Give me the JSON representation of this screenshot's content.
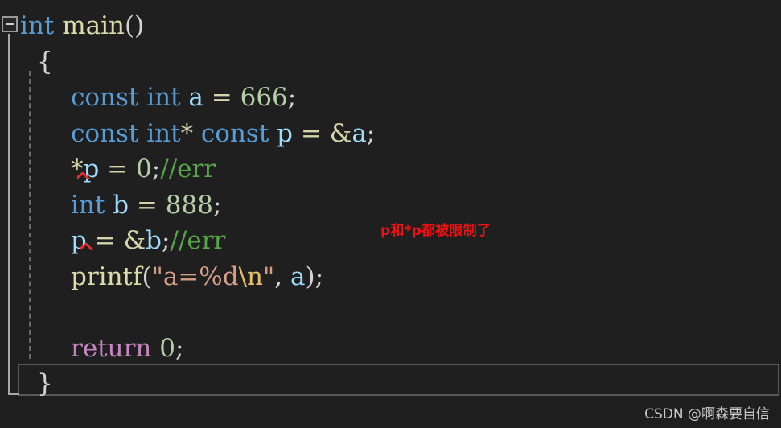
{
  "editor": {
    "background_color": "#1f1f1f",
    "outlining": {
      "collapse_toggle_state": "expanded",
      "collapse_glyph": "minus-box"
    },
    "current_line_number": 12,
    "code_lines": [
      {
        "id": "line-1",
        "indent": 0,
        "tokens": [
          {
            "t": "int",
            "c": "kw"
          },
          {
            "t": " ",
            "c": "punct"
          },
          {
            "t": "main",
            "c": "fn"
          },
          {
            "t": "()",
            "c": "brace"
          }
        ]
      },
      {
        "id": "line-2",
        "indent": 1,
        "tokens": [
          {
            "t": "{",
            "c": "brace"
          }
        ]
      },
      {
        "id": "line-3",
        "indent": 3,
        "tokens": [
          {
            "t": "const",
            "c": "kw"
          },
          {
            "t": " ",
            "c": "punct"
          },
          {
            "t": "int",
            "c": "kw"
          },
          {
            "t": " ",
            "c": "punct"
          },
          {
            "t": "a",
            "c": "ident"
          },
          {
            "t": " ",
            "c": "punct"
          },
          {
            "t": "=",
            "c": "op"
          },
          {
            "t": " ",
            "c": "punct"
          },
          {
            "t": "666",
            "c": "num"
          },
          {
            "t": ";",
            "c": "punct"
          }
        ]
      },
      {
        "id": "line-4",
        "indent": 3,
        "tokens": [
          {
            "t": "const",
            "c": "kw"
          },
          {
            "t": " ",
            "c": "punct"
          },
          {
            "t": "int",
            "c": "kw"
          },
          {
            "t": "*",
            "c": "op"
          },
          {
            "t": " ",
            "c": "punct"
          },
          {
            "t": "const",
            "c": "kw"
          },
          {
            "t": " ",
            "c": "punct"
          },
          {
            "t": "p",
            "c": "ident"
          },
          {
            "t": " ",
            "c": "punct"
          },
          {
            "t": "=",
            "c": "op"
          },
          {
            "t": " ",
            "c": "punct"
          },
          {
            "t": "&",
            "c": "op"
          },
          {
            "t": "a",
            "c": "ident"
          },
          {
            "t": ";",
            "c": "punct"
          }
        ]
      },
      {
        "id": "line-5",
        "indent": 3,
        "has_error": true,
        "tokens": [
          {
            "t": "*",
            "c": "op"
          },
          {
            "t": "p",
            "c": "ident"
          },
          {
            "t": " ",
            "c": "punct"
          },
          {
            "t": "=",
            "c": "op"
          },
          {
            "t": " ",
            "c": "punct"
          },
          {
            "t": "0",
            "c": "num"
          },
          {
            "t": ";",
            "c": "punct"
          },
          {
            "t": "//err",
            "c": "cmt"
          }
        ]
      },
      {
        "id": "line-6",
        "indent": 3,
        "tokens": [
          {
            "t": "int",
            "c": "kw"
          },
          {
            "t": " ",
            "c": "punct"
          },
          {
            "t": "b",
            "c": "ident"
          },
          {
            "t": " ",
            "c": "punct"
          },
          {
            "t": "=",
            "c": "op"
          },
          {
            "t": " ",
            "c": "punct"
          },
          {
            "t": "888",
            "c": "num"
          },
          {
            "t": ";",
            "c": "punct"
          }
        ]
      },
      {
        "id": "line-7",
        "indent": 3,
        "has_error": true,
        "tokens": [
          {
            "t": "p",
            "c": "ident"
          },
          {
            "t": " ",
            "c": "punct"
          },
          {
            "t": "=",
            "c": "op"
          },
          {
            "t": " ",
            "c": "punct"
          },
          {
            "t": "&",
            "c": "op"
          },
          {
            "t": "b",
            "c": "ident"
          },
          {
            "t": ";",
            "c": "punct"
          },
          {
            "t": "//err",
            "c": "cmt"
          }
        ]
      },
      {
        "id": "line-8",
        "indent": 3,
        "tokens": [
          {
            "t": "printf",
            "c": "fn"
          },
          {
            "t": "(",
            "c": "brace"
          },
          {
            "t": "\"a=%d",
            "c": "str"
          },
          {
            "t": "\\n",
            "c": "esc"
          },
          {
            "t": "\"",
            "c": "str"
          },
          {
            "t": ", ",
            "c": "punct"
          },
          {
            "t": "a",
            "c": "ident"
          },
          {
            "t": ")",
            "c": "brace"
          },
          {
            "t": ";",
            "c": "punct"
          }
        ]
      },
      {
        "id": "line-9",
        "indent": 3,
        "tokens": []
      },
      {
        "id": "line-10",
        "indent": 3,
        "tokens": [
          {
            "t": "return",
            "c": "ctrl"
          },
          {
            "t": " ",
            "c": "punct"
          },
          {
            "t": "0",
            "c": "num"
          },
          {
            "t": ";",
            "c": "punct"
          }
        ]
      },
      {
        "id": "line-11",
        "indent": 1,
        "is_current": true,
        "tokens": [
          {
            "t": "}",
            "c": "brace"
          }
        ]
      }
    ],
    "plain_source": "int main()\n{\n    const int a = 666;\n    const int* const p = &a;\n    *p = 0;//err\n    int b = 888;\n    p = &b;//err\n    printf(\"a=%d\\n\", a);\n\n    return 0;\n}",
    "error_squiggles": [
      {
        "id": "squiggle-star-p",
        "target": "*p",
        "line": "line-5",
        "color": "#e03030"
      },
      {
        "id": "squiggle-p",
        "target": "p",
        "line": "line-7",
        "color": "#e03030"
      }
    ]
  },
  "annotation": {
    "text": "p和*p都被限制了",
    "color": "#ee1111"
  },
  "watermark": {
    "text": "CSDN @啊森要自信",
    "color": "#c9c9c9"
  },
  "theme": {
    "keyword": "#569cd6",
    "identifier": "#9cdcfe",
    "number": "#b5cea8",
    "comment": "#57a64a",
    "string": "#d69d85",
    "escape": "#e8c06a",
    "function": "#dcdcaa",
    "control_keyword": "#c586c0",
    "operator": "#d4d4aa",
    "punctuation": "#d4d4d4",
    "background": "#1f1f1f",
    "current_line_border": "#585858",
    "outline_line": "#a8a8a8",
    "indent_guide": "#6a6a6a"
  }
}
